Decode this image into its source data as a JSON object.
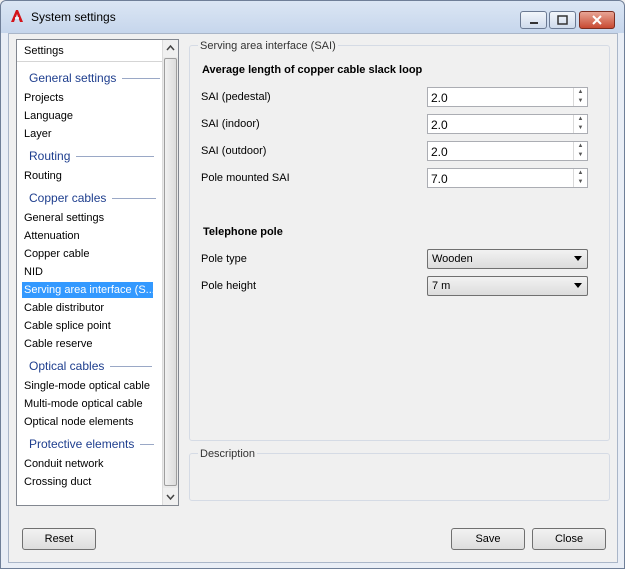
{
  "window": {
    "title": "System settings"
  },
  "tree": {
    "header": "Settings",
    "groups": {
      "general": "General settings",
      "routing": "Routing",
      "copper": "Copper cables",
      "optical": "Optical cables",
      "protective": "Protective elements"
    },
    "items": {
      "projects": "Projects",
      "language": "Language",
      "layer": "Layer",
      "routing": "Routing",
      "copper_general": "General settings",
      "attenuation": "Attenuation",
      "copper_cable": "Copper cable",
      "nid": "NID",
      "sai": "Serving area interface (S...",
      "cable_distributor": "Cable distributor",
      "cable_splice": "Cable splice point",
      "cable_reserve": "Cable reserve",
      "single_mode": "Single-mode optical cable",
      "multi_mode": "Multi-mode optical cable",
      "optical_node": "Optical node elements",
      "conduit": "Conduit network",
      "crossing": "Crossing duct"
    }
  },
  "sai_panel": {
    "title": "Serving area interface (SAI)",
    "heading": "Average length of copper cable slack loop",
    "fields": [
      {
        "label": "SAI (pedestal)",
        "value": "2.0"
      },
      {
        "label": "SAI (indoor)",
        "value": "2.0"
      },
      {
        "label": "SAI (outdoor)",
        "value": "2.0"
      },
      {
        "label": "Pole mounted SAI",
        "value": "7.0"
      }
    ],
    "pole_heading": "Telephone pole",
    "pole_type": {
      "label": "Pole type",
      "value": "Wooden"
    },
    "pole_height": {
      "label": "Pole height",
      "value": "7 m"
    }
  },
  "description_panel": {
    "title": "Description"
  },
  "buttons": {
    "reset": "Reset",
    "save": "Save",
    "close": "Close"
  }
}
